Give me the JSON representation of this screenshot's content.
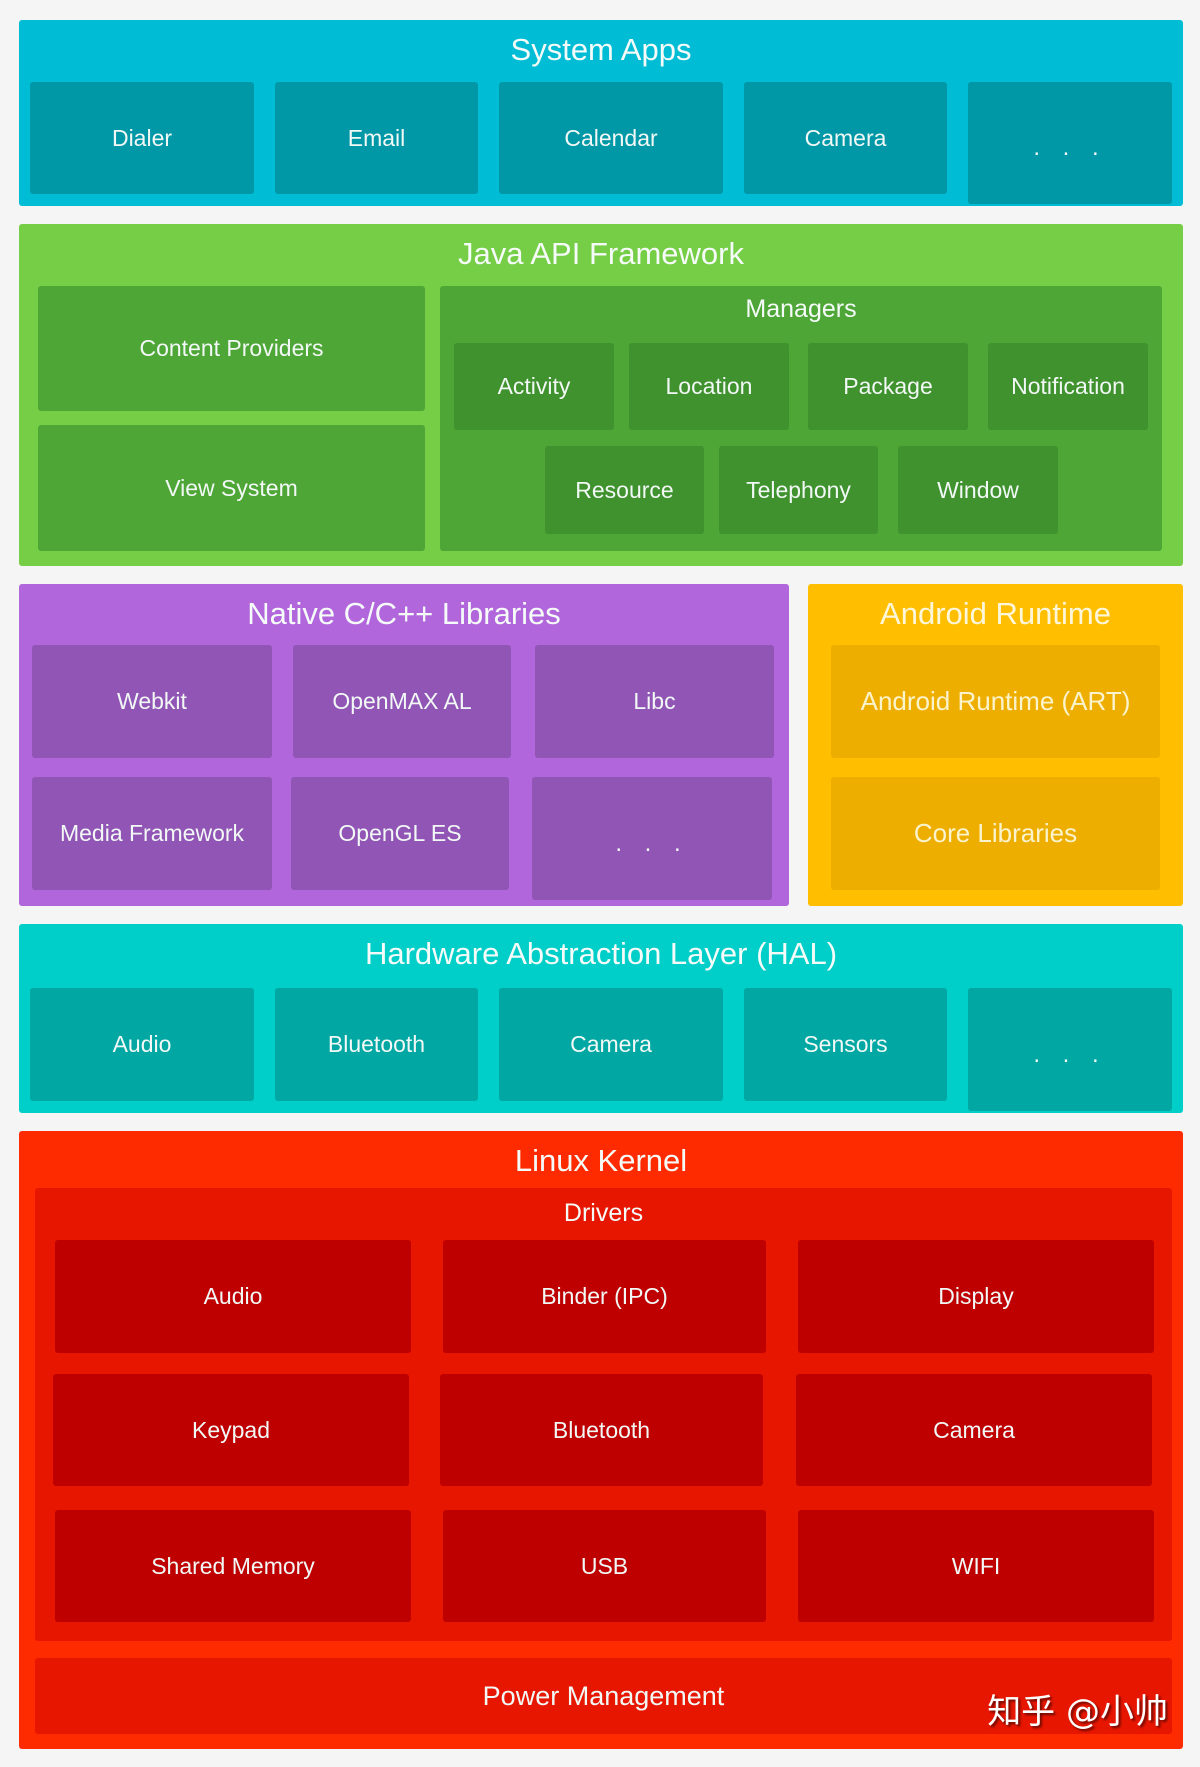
{
  "system_apps": {
    "title": "System Apps",
    "items": [
      "Dialer",
      "Email",
      "Calendar",
      "Camera",
      ". . ."
    ]
  },
  "java_api": {
    "title": "Java API Framework",
    "content_providers": "Content Providers",
    "view_system": "View System",
    "managers": {
      "title": "Managers",
      "row1": [
        "Activity",
        "Location",
        "Package",
        "Notification"
      ],
      "row2": [
        "Resource",
        "Telephony",
        "Window"
      ]
    }
  },
  "native_libraries": {
    "title": "Native C/C++ Libraries",
    "items": [
      "Webkit",
      "OpenMAX AL",
      "Libc",
      "Media Framework",
      "OpenGL ES",
      ". . ."
    ]
  },
  "android_runtime": {
    "title": "Android Runtime",
    "items": [
      "Android Runtime (ART)",
      "Core Libraries"
    ]
  },
  "hal": {
    "title": "Hardware Abstraction Layer (HAL)",
    "items": [
      "Audio",
      "Bluetooth",
      "Camera",
      "Sensors",
      ". . ."
    ]
  },
  "linux_kernel": {
    "title": "Linux Kernel",
    "drivers": {
      "title": "Drivers",
      "items": [
        "Audio",
        "Binder (IPC)",
        "Display",
        "Keypad",
        "Bluetooth",
        "Camera",
        "Shared Memory",
        "USB",
        "WIFI"
      ]
    },
    "power_management": "Power Management"
  },
  "watermark": "知乎 @小帅",
  "colors": {
    "system_apps": "#00bcd4",
    "java_api": "#76cd46",
    "native": "#b266dc",
    "runtime": "#ffbf00",
    "hal": "#00cec8",
    "kernel": "#ff2b00"
  }
}
